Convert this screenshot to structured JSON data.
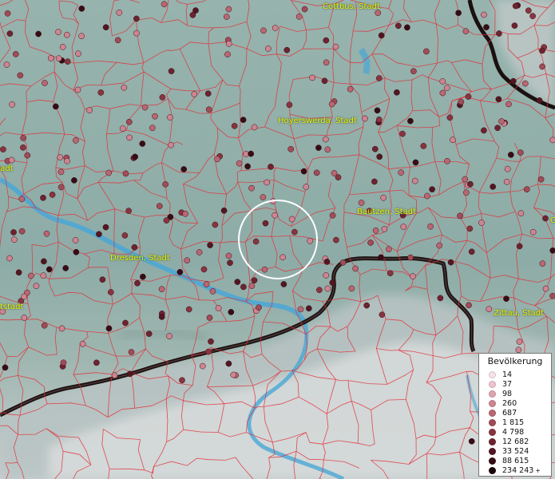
{
  "cities": [
    {
      "name": "Cottbus, Stadt"
    },
    {
      "name": "Hoyerswerda, Stadt"
    },
    {
      "name": "Bautzen, Stadt"
    },
    {
      "name": "Dresden, Stadt"
    },
    {
      "name": "Zittau, Stadt"
    },
    {
      "name": "tstadt"
    },
    {
      "name": "Stadt"
    },
    {
      "name": "G"
    }
  ],
  "legend": {
    "title": "Bevölkerung",
    "items": [
      {
        "label": "14",
        "color": "#f7e1ea"
      },
      {
        "label": "37",
        "color": "#eec4cf"
      },
      {
        "label": "98",
        "color": "#dfa4b0"
      },
      {
        "label": "260",
        "color": "#cd8591"
      },
      {
        "label": "687",
        "color": "#b96773"
      },
      {
        "label": "1 815",
        "color": "#a14c58"
      },
      {
        "label": "4 798",
        "color": "#883540"
      },
      {
        "label": "12 682",
        "color": "#6d2430"
      },
      {
        "label": "33 524",
        "color": "#521722"
      },
      {
        "label": "88 615",
        "color": "#360d16"
      },
      {
        "label": "234 243",
        "color": "#1a0509",
        "suffix": "+"
      }
    ]
  }
}
